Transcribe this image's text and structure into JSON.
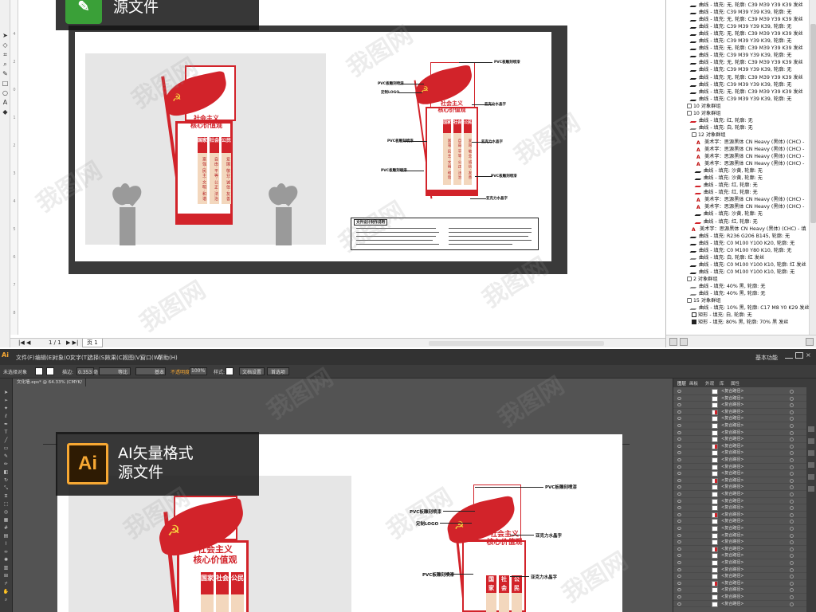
{
  "cdr": {
    "badge_line1": "",
    "badge_line2": "源文件",
    "status": {
      "nav": "|◀ ◀",
      "page_counter": "1 / 1",
      "nav_next": "▶ ▶|",
      "page_tab": "页 1"
    },
    "ruler_marks": [
      "4",
      "2",
      "0",
      "1",
      "2",
      "3",
      "4",
      "5",
      "6",
      "7",
      "8",
      "9",
      "10"
    ],
    "object_manager": [
      {
        "indent": 1,
        "icon": "pen",
        "text": "曲线 - 填充: 无, 轮廓: C39 M39 Y39 K39 发丝"
      },
      {
        "indent": 1,
        "icon": "pen",
        "text": "曲线 - 填充: C39 M39 Y39 K39, 轮廓: 无"
      },
      {
        "indent": 1,
        "icon": "pen",
        "text": "曲线 - 填充: 无, 轮廓: C39 M39 Y39 K39 发丝"
      },
      {
        "indent": 1,
        "icon": "pen",
        "text": "曲线 - 填充: C39 M39 Y39 K39, 轮廓: 无"
      },
      {
        "indent": 1,
        "icon": "pen",
        "text": "曲线 - 填充: 无, 轮廓: C39 M39 Y39 K39 发丝"
      },
      {
        "indent": 1,
        "icon": "pen",
        "text": "曲线 - 填充: C39 M39 Y39 K39, 轮廓: 无"
      },
      {
        "indent": 1,
        "icon": "pen",
        "text": "曲线 - 填充: 无, 轮廓: C39 M39 Y39 K39 发丝"
      },
      {
        "indent": 1,
        "icon": "pen",
        "text": "曲线 - 填充: C39 M39 Y39 K39, 轮廓: 无"
      },
      {
        "indent": 1,
        "icon": "pen",
        "text": "曲线 - 填充: 无, 轮廓: C39 M39 Y39 K39 发丝"
      },
      {
        "indent": 1,
        "icon": "pen",
        "text": "曲线 - 填充: C39 M39 Y39 K39, 轮廓: 无"
      },
      {
        "indent": 1,
        "icon": "pen",
        "text": "曲线 - 填充: 无, 轮廓: C39 M39 Y39 K39 发丝"
      },
      {
        "indent": 1,
        "icon": "pen",
        "text": "曲线 - 填充: C39 M39 Y39 K39, 轮廓: 无"
      },
      {
        "indent": 1,
        "icon": "pen",
        "text": "曲线 - 填充: 无, 轮廓: C39 M39 Y39 K39 发丝"
      },
      {
        "indent": 1,
        "icon": "pen",
        "text": "曲线 - 填充: C39 M39 Y39 K39, 轮廓: 无"
      },
      {
        "indent": 0,
        "icon": "grp",
        "text": "10 对象群组"
      },
      {
        "indent": 0,
        "icon": "grp",
        "text": "10 对象群组"
      },
      {
        "indent": 1,
        "icon": "pen red",
        "text": "曲线 - 填充: 红, 轮廓: 无"
      },
      {
        "indent": 1,
        "icon": "pen grey",
        "text": "曲线 - 填充: 白, 轮廓: 无"
      },
      {
        "indent": 1,
        "icon": "grp",
        "text": "12 对象群组"
      },
      {
        "indent": 2,
        "icon": "txt",
        "text": "美术字：思源黑体 CN Heavy (黑体) (CHC) -"
      },
      {
        "indent": 2,
        "icon": "txt",
        "text": "美术字：思源黑体 CN Heavy (黑体) (CHC) -"
      },
      {
        "indent": 2,
        "icon": "txt",
        "text": "美术字：思源黑体 CN Heavy (黑体) (CHC) -"
      },
      {
        "indent": 2,
        "icon": "txt",
        "text": "美术字：思源黑体 CN Heavy (黑体) (CHC) -"
      },
      {
        "indent": 2,
        "icon": "pen",
        "text": "曲线 - 填充: 沙黄, 轮廓: 无"
      },
      {
        "indent": 2,
        "icon": "pen",
        "text": "曲线 - 填充: 沙黄, 轮廓: 无"
      },
      {
        "indent": 2,
        "icon": "pen red",
        "text": "曲线 - 填充: 红, 轮廓: 无"
      },
      {
        "indent": 2,
        "icon": "pen red",
        "text": "曲线 - 填充: 红, 轮廓: 无"
      },
      {
        "indent": 2,
        "icon": "txt",
        "text": "美术字：思源黑体 CN Heavy (黑体) (CHC) -"
      },
      {
        "indent": 2,
        "icon": "txt",
        "text": "美术字：思源黑体 CN Heavy (黑体) (CHC) -"
      },
      {
        "indent": 2,
        "icon": "pen",
        "text": "曲线 - 填充: 沙黄, 轮廓: 无"
      },
      {
        "indent": 2,
        "icon": "pen red",
        "text": "曲线 - 填充: 红, 轮廓: 无"
      },
      {
        "indent": 1,
        "icon": "txt",
        "text": "美术字：思源黑体 CN Heavy (黑体) (CHC) - 填"
      },
      {
        "indent": 1,
        "icon": "pen",
        "text": "曲线 - 填充: R236 G206 B145, 轮廓: 无"
      },
      {
        "indent": 1,
        "icon": "pen",
        "text": "曲线 - 填充: C0 M100 Y100 K20, 轮廓: 无"
      },
      {
        "indent": 1,
        "icon": "pen",
        "text": "曲线 - 填充: C0 M100 Y80 K10, 轮廓: 无"
      },
      {
        "indent": 1,
        "icon": "pen grey",
        "text": "曲线 - 填充: 白, 轮廓: 红 发丝"
      },
      {
        "indent": 1,
        "icon": "pen",
        "text": "曲线 - 填充: C0 M100 Y100 K10, 轮廓: 红 发丝"
      },
      {
        "indent": 1,
        "icon": "pen",
        "text": "曲线 - 填充: C0 M100 Y100 K10, 轮廓: 无"
      },
      {
        "indent": 0,
        "icon": "grp",
        "text": "2 对象群组"
      },
      {
        "indent": 1,
        "icon": "pen grey",
        "text": "曲线 - 填充: 40% 黑, 轮廓: 无"
      },
      {
        "indent": 1,
        "icon": "pen grey",
        "text": "曲线 - 填充: 40% 黑, 轮廓: 无"
      },
      {
        "indent": 0,
        "icon": "grp",
        "text": "15 对象群组"
      },
      {
        "indent": 1,
        "icon": "pen grey",
        "text": "曲线 - 填充: 10% 黑, 轮廓: C17 M8 Y0 K29 发丝"
      },
      {
        "indent": 1,
        "icon": "rect",
        "text": "矩形 - 填充: 白, 轮廓: 无"
      },
      {
        "indent": 1,
        "icon": "rect fill",
        "text": "矩形 - 填充: 80% 黑, 轮廓: 70% 黑 发丝"
      }
    ]
  },
  "artwork": {
    "sign_title_1": "社会主义",
    "sign_title_2": "核心价值观",
    "columns": [
      {
        "head": "国家",
        "body": "富强·民主·文明·和谐"
      },
      {
        "head": "社会",
        "body": "自由·平等·公正·法治"
      },
      {
        "head": "公民",
        "body": "爱国·敬业·诚信·友善"
      }
    ],
    "callouts": {
      "pvc_top": "PVC板雕刻喷漆",
      "pvc_left1": "PVC板雕刻喷漆",
      "logo": "定制LOGO",
      "acrylic1": "亚克力水晶字",
      "pvc_left2": "PVC板雕刻喷漆",
      "acrylic2": "亚克力水晶字",
      "pvc_left3": "PVC板雕刻喷漆",
      "pvc_right": "PVC板雕刻喷漆",
      "acrylic3": "亚克力水晶字"
    },
    "spec_title": "文件设计制作说明"
  },
  "ai": {
    "menubar": {
      "logo": "Ai",
      "items": [
        "文件(F)",
        "编辑(E)",
        "对象(O)",
        "文字(T)",
        "选择(S)",
        "效果(C)",
        "视图(V)",
        "窗口(W)",
        "帮助(H)"
      ],
      "workspace": "基本功能"
    },
    "control": {
      "no_selection": "未选择对象",
      "stroke_label": "描边:",
      "stroke_value": "0.353 毫",
      "uniform": "等比",
      "basic": "基本",
      "opacity_label": "不透明度:",
      "opacity_value": "100%",
      "style_label": "样式:",
      "doc_setup": "文档设置",
      "prefs": "首选项"
    },
    "doc_tab": "文化墙.eps* @ 64.33% (CMYK/预览)",
    "badge_logo": "Ai",
    "badge_line1": "AI矢量格式",
    "badge_line2": "源文件",
    "layers": {
      "tabs": [
        "图层",
        "画板",
        "外观",
        "库",
        "属性"
      ],
      "rows": [
        "<复合路径>",
        "<复合路径>",
        "<复合路径>",
        "<复合路径>",
        "<复合路径>",
        "<复合路径>",
        "<复合路径>",
        "<复合路径>",
        "<复合路径>",
        "<复合路径>",
        "<复合路径>",
        "<复合路径>",
        "<复合路径>",
        "<复合路径>",
        "<复合路径>",
        "<复合路径>",
        "<复合路径>",
        "<复合路径>",
        "<复合路径>",
        "<复合路径>",
        "<复合路径>",
        "<复合路径>",
        "<复合路径>",
        "<复合路径>",
        "<复合路径>",
        "<复合路径>",
        "<复合路径>",
        "<复合路径>",
        "<复合路径>",
        "<复合路径>",
        "<复合路径>",
        "<复合路径>"
      ]
    }
  },
  "watermark": "我图网",
  "colors": {
    "party_red": "#d2232a",
    "gold": "#f7d23e",
    "sand": "#f3d7bd",
    "cdr_green": "#3aa038",
    "ai_orange": "#f7a833",
    "ai_dark": "#2e1b03"
  }
}
